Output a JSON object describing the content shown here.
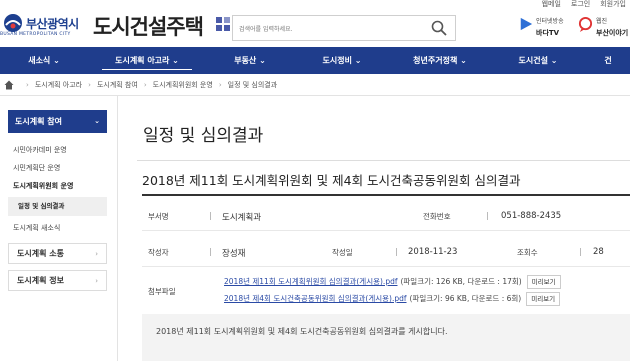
{
  "util": {
    "links": [
      "웹메일",
      "로그인",
      "회원가입"
    ]
  },
  "header": {
    "logo_text": "부산광역시",
    "logo_sub": "BUSAN METROPOLITAN CITY",
    "site_title": "도시건설주택",
    "search_placeholder": "검색어를 입력하세요.",
    "quick": [
      {
        "label_top": "인터넷방송",
        "label_bottom": "바다TV"
      },
      {
        "label_top": "웹진",
        "label_bottom": "부산이야기"
      }
    ]
  },
  "nav": {
    "items": [
      {
        "label": "새소식 ⌄",
        "active": false
      },
      {
        "label": "도시계획 아고라 ⌄",
        "active": true
      },
      {
        "label": "부동산 ⌄",
        "active": false
      },
      {
        "label": "도시정비 ⌄",
        "active": false
      },
      {
        "label": "청년주거정책 ⌄",
        "active": false
      },
      {
        "label": "도시건설 ⌄",
        "active": false
      },
      {
        "label": "건",
        "active": false
      }
    ]
  },
  "breadcrumb": [
    "도시계획 아고라",
    "도시계획 참여",
    "도시계획위원회 운영",
    "일정 및 심의결과"
  ],
  "sidebar": {
    "head": "도시계획 참여",
    "items": [
      "시민아카데미 운영",
      "시민계획단 운영",
      "도시계획위원회 운영"
    ],
    "sub_active": "일정 및 심의결과",
    "items_after": [
      "도시계획 새소식"
    ],
    "boxes": [
      "도시계획 소통",
      "도시계획 정보"
    ]
  },
  "content": {
    "page_title": "일정 및 심의결과",
    "post_title": "2018년 제11회 도시계획위원회 및 제4회 도시건축공동위원회 심의결과",
    "dept_label": "부서명",
    "dept_value": "도시계획과",
    "phone_label": "전화번호",
    "phone_value": "051-888-2435",
    "author_label": "작성자",
    "author_value": "장성재",
    "date_label": "작성일",
    "date_value": "2018-11-23",
    "views_label": "조회수",
    "views_value": "28",
    "attach_label": "첨부파일",
    "attachments": [
      {
        "name": "2018년 제11회 도시계획위원회 심의결과(게시용).pdf",
        "meta": "(파일크기: 126 KB, 다운로드 : 17회)",
        "preview": "미리보기"
      },
      {
        "name": "2018년 제4회 도시건축공동위원회 심의결과(게시용).pdf",
        "meta": "(파일크기: 96 KB, 다운로드 : 6회)",
        "preview": "미리보기"
      }
    ],
    "body": "2018년 제11회 도시계획위원회 및 제4회 도시건축공동위원회 심의결과를 게시합니다."
  },
  "colors": {
    "brand": "#1f3d8c",
    "link": "#2a4aa5"
  }
}
